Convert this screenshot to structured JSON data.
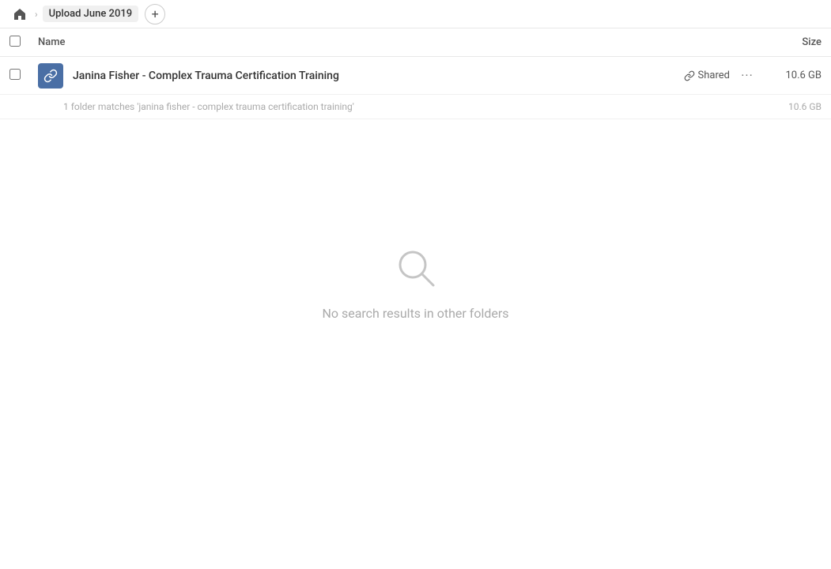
{
  "breadcrumb": {
    "home_label": "Home",
    "current_folder": "Upload June 2019",
    "add_label": "+"
  },
  "table_header": {
    "name_label": "Name",
    "size_label": "Size"
  },
  "file_row": {
    "name": "Janina Fisher - Complex Trauma Certification Training",
    "shared_label": "Shared",
    "more_label": "···",
    "size": "10.6 GB"
  },
  "match_info": {
    "text": "1 folder matches 'janina fisher - complex trauma certification training'",
    "size": "10.6 GB"
  },
  "empty_state": {
    "text": "No search results in other folders"
  }
}
